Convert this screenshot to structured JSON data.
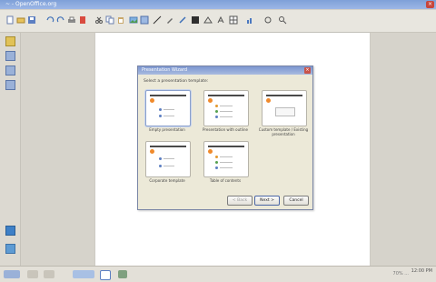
{
  "window": {
    "title": "~ - OpenOffice.org",
    "close_glyph": "×"
  },
  "toolbar": {
    "icons": [
      "new-icon",
      "open-icon",
      "save-icon",
      "undo-icon",
      "redo-icon",
      "print-icon",
      "pdf-icon",
      "cut-icon",
      "copy-icon",
      "paste-icon",
      "image-icon",
      "gallery-icon",
      "line-icon",
      "pen-icon",
      "brush-icon",
      "text-icon",
      "shape-icon",
      "font-icon",
      "table-icon"
    ]
  },
  "sidebar": {
    "icons": [
      "layout-icon",
      "slide-icon",
      "tools-icon",
      "shapes-icon",
      "color-icon",
      "help-icon"
    ]
  },
  "dialog": {
    "title": "Presentation Wizard",
    "close_glyph": "×",
    "prompt": "Select a presentation template:",
    "cards": [
      {
        "caption": "Empty presentation"
      },
      {
        "caption": "Presentation with outline"
      },
      {
        "caption": "Custom template / Existing presentation"
      },
      {
        "caption": "Corporate template"
      },
      {
        "caption": "Table of contents"
      }
    ],
    "buttons": {
      "back": "< Back",
      "next": "Next >",
      "cancel": "Cancel"
    }
  },
  "statusbar": {
    "right_text": "70% ...",
    "clock": "12:00 PM"
  },
  "colors": {
    "accent": "#7b96cf",
    "canvas": "#ffffff",
    "logo": "#f08a2c"
  }
}
